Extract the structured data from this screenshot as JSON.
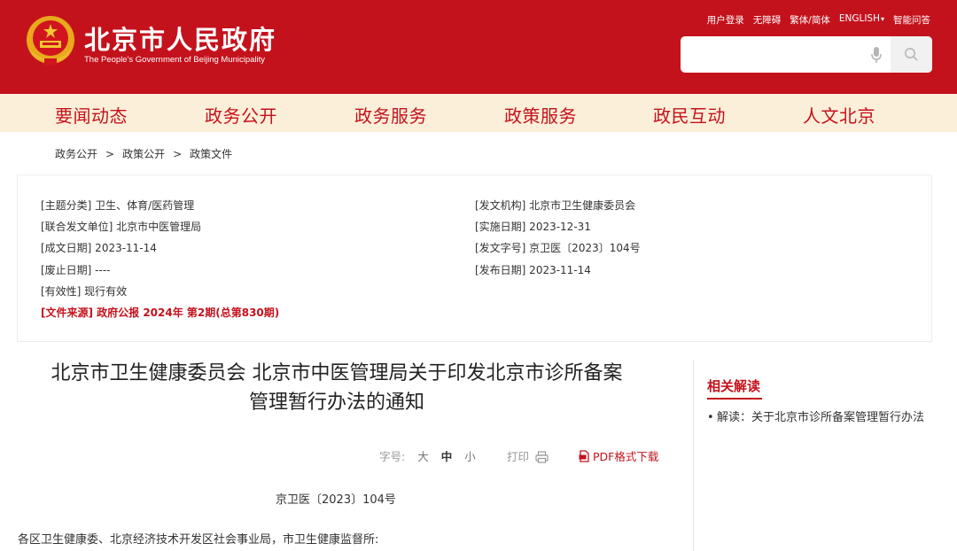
{
  "header": {
    "site_name": "北京市人民政府",
    "site_subtitle": "The People's Government of Beijing Municipality",
    "links": [
      "用户登录",
      "无障碍",
      "繁体/简体",
      "ENGLISH",
      "智能问答"
    ],
    "search_placeholder": "",
    "brand_color": "#c4121c"
  },
  "nav": {
    "items": [
      "要闻动态",
      "政务公开",
      "政务服务",
      "政策服务",
      "政民互动",
      "人文北京"
    ],
    "background": "#fcefd9"
  },
  "breadcrumb": [
    "政务公开",
    "政策公开",
    "政策文件"
  ],
  "breadcrumb_sep": ">",
  "info": {
    "left": [
      "[主题分类] 卫生、体育/医药管理",
      "[联合发文单位] 北京市中医管理局",
      "[成文日期] 2023-11-14",
      "[废止日期] ----",
      "[有效性] 现行有效"
    ],
    "source": "[文件来源] 政府公报 2024年 第2期(总第830期)",
    "right": [
      "[发文机构] 北京市卫生健康委员会",
      "[实施日期] 2023-12-31",
      "[发文字号] 京卫医〔2023〕104号",
      "[发布日期] 2023-11-14"
    ]
  },
  "article": {
    "title_line1": "北京市卫生健康委员会 北京市中医管理局关于印发北京市诊所备案",
    "title_line2": "管理暂行办法的通知",
    "font_label": "字号:",
    "sizes": [
      "大",
      "中",
      "小"
    ],
    "print_label": "打印",
    "pdf_label": "PDF格式下载",
    "doc_number": "京卫医〔2023〕104号",
    "addressee": "各区卫生健康委、北京经济技术开发区社会事业局，市卫生健康监督所:"
  },
  "sidebar": {
    "title": "相关解读",
    "bullet": "•",
    "items": [
      "解读：关于北京市诊所备案管理暂行办法"
    ]
  }
}
